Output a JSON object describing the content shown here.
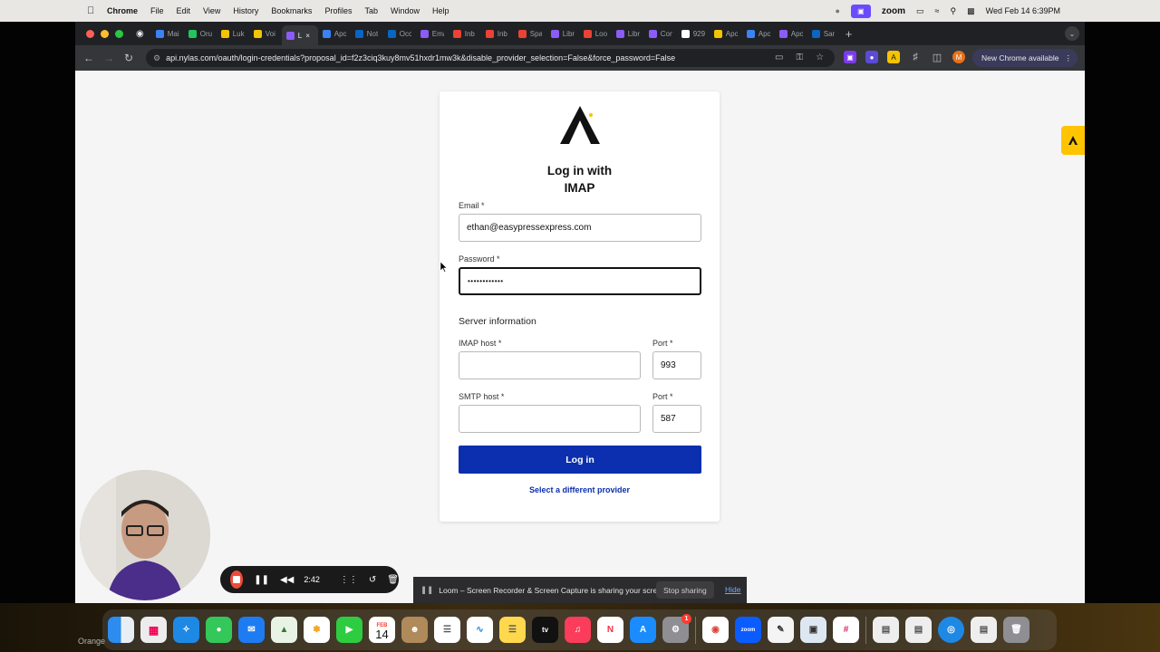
{
  "menubar": {
    "app": "Chrome",
    "items": [
      "File",
      "Edit",
      "View",
      "History",
      "Bookmarks",
      "Profiles",
      "Tab",
      "Window",
      "Help"
    ],
    "zoom_label": "zoom",
    "clock": "Wed Feb 14  6:39PM"
  },
  "browser": {
    "tabs": [
      {
        "label": "Mail",
        "color": "#3b82f6"
      },
      {
        "label": "Oru",
        "color": "#22c55e"
      },
      {
        "label": "Luk",
        "color": "#f5c400"
      },
      {
        "label": "Voi",
        "color": "#f5c400"
      },
      {
        "label": "L",
        "color": "#8b5cf6"
      },
      {
        "label": "Apo",
        "color": "#3b82f6"
      },
      {
        "label": "Not",
        "color": "#0a66c2"
      },
      {
        "label": "Occ",
        "color": "#0a66c2"
      },
      {
        "label": "Ema",
        "color": "#8b5cf6"
      },
      {
        "label": "Inb",
        "color": "#ea4335"
      },
      {
        "label": "Inb",
        "color": "#ea4335"
      },
      {
        "label": "Spa",
        "color": "#ea4335"
      },
      {
        "label": "Libr",
        "color": "#8b5cf6"
      },
      {
        "label": "Loo",
        "color": "#ea4335"
      },
      {
        "label": "Libr",
        "color": "#8b5cf6"
      },
      {
        "label": "Con",
        "color": "#8b5cf6"
      },
      {
        "label": "929",
        "color": "#ffffff"
      },
      {
        "label": "Apo",
        "color": "#f5c400"
      },
      {
        "label": "Apo",
        "color": "#3b82f6"
      },
      {
        "label": "Apo",
        "color": "#8b5cf6"
      },
      {
        "label": "Sar",
        "color": "#0a66c2"
      }
    ],
    "active_tab_index": 4,
    "url": "api.nylas.com/oauth/login-credentials?proposal_id=f2z3ciq3kuy8mv51hxdr1mw3k&disable_provider_selection=False&force_password=False",
    "update_label": "New Chrome available"
  },
  "login": {
    "title_line1": "Log in with",
    "title_line2": "IMAP",
    "email_label": "Email *",
    "email_value": "ethan@easypressexpress.com",
    "password_label": "Password *",
    "password_value": "••••••••••••",
    "server_section": "Server information",
    "imap_host_label": "IMAP host *",
    "imap_host_value": "",
    "imap_port_label": "Port *",
    "imap_port_value": "993",
    "smtp_host_label": "SMTP host *",
    "smtp_host_value": "",
    "smtp_port_label": "Port *",
    "smtp_port_value": "587",
    "login_button": "Log in",
    "alt_provider_link": "Select a different provider"
  },
  "recorder": {
    "time": "2:42"
  },
  "share_bar": {
    "message": "Loom – Screen Recorder & Screen Capture is sharing your screen.",
    "stop_label": "Stop sharing",
    "hide_label": "Hide"
  },
  "dock": {
    "calendar_month": "FEB",
    "calendar_day": "14",
    "settings_badge": "1"
  },
  "desktop": {
    "label": "Orange"
  }
}
